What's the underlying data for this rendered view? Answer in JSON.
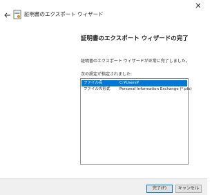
{
  "window": {
    "close_glyph": "✕",
    "back_glyph": "←",
    "title": "証明書のエクスポート ウィザード"
  },
  "content": {
    "heading": "証明書のエクスポート ウィザードの完了",
    "message": "証明書のエクスポート ウィザードが正常に完了しました。",
    "settings_label": "次の設定が指定されました:",
    "settings": [
      {
        "name": "ファイル名",
        "value": "C:¥Users¥"
      },
      {
        "name": "ファイルの形式",
        "value": "Personal Information Exchange (*.pfx)"
      }
    ]
  },
  "buttons": {
    "finish": "完了(F)",
    "cancel": "キャンセル"
  },
  "colors": {
    "accent": "#0078d7",
    "footer": "#f0f0f0"
  },
  "icons": {
    "back": "back-arrow-icon",
    "wizard": "certificate-icon",
    "close": "close-icon"
  }
}
